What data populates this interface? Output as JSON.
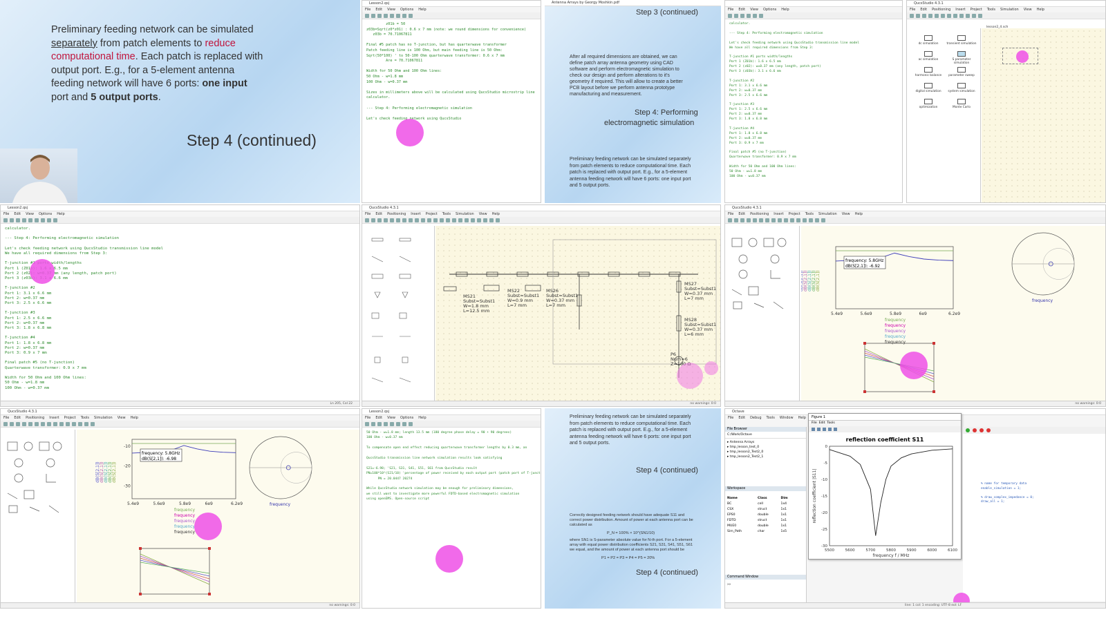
{
  "tiles": {
    "t1": {
      "text_lines": [
        {
          "parts": [
            [
              "Preliminary feeding network can be simulated",
              ""
            ]
          ]
        },
        {
          "parts": [
            [
              "separately",
              "u"
            ],
            [
              " from patch elements to ",
              ""
            ],
            [
              "reduce",
              "red"
            ]
          ]
        },
        {
          "parts": [
            [
              "computational time",
              "red"
            ],
            [
              ". Each patch is replaced with",
              ""
            ]
          ]
        },
        {
          "parts": [
            [
              "output port. E.g., for a 5-element antenna",
              ""
            ]
          ]
        },
        {
          "parts": [
            [
              "feeding network will have 6 ports: ",
              ""
            ],
            [
              "one input",
              "bold"
            ]
          ]
        },
        {
          "parts": [
            [
              "port and ",
              ""
            ],
            [
              "5 output ports",
              "bold"
            ],
            [
              ".",
              ""
            ]
          ]
        }
      ],
      "step": "Step 4 (continued)"
    },
    "t2": {
      "title": "Lesson2.qsj",
      "menu": [
        "File",
        "Edit",
        "View",
        "Options",
        "Help"
      ],
      "lines": [
        "         z01b = 50",
        "z03b=Sqrt(z0*z01) : 0.6 x 7 mm (note: we round dimensions for convenience)",
        "   z03b = 70.71067811",
        "",
        "Final #5 patch has no T-junction, but has quarterwave transformer",
        "Patch feeding line is 100 Ohm, but main feeding line is 50 Ohm:",
        "Sqrt(50*100) ' to 50-100 Ohm quarterwave transformer: 0.6 x 7 mm",
        "         Are = 70.71067811",
        "",
        "Width for 50 Ohm and 100 Ohm lines:",
        "50 Ohm - w=1.8 mm",
        "100 Ohm - w=0.37 mm",
        "",
        "Sizes in millimeters above will be calculated using QucsStudio microstrip line",
        "calculator.",
        "",
        "--- Step 4: Performing electromagnetic simulation",
        "",
        "Let's check feeding network using QucsStudio"
      ]
    },
    "t3": {
      "title": "Antenna Arrays by Georgy Moshkin.pdf",
      "step_top": "Step 3 (continued)",
      "para1": "After all required dimensions are obtained, we can define patch array antenna geometry using CAD software and perform electromagnetic simulation to check our design and perform alterations to it's geometry if required. This will allow to create a better PCB layout before we perform antenna prototype manufacturing and measurement.",
      "step4a": "Step 4: Performing",
      "step4b": "electromagnetic simulation",
      "para2": "Preliminary feeding network can be simulated separately from patch elements to reduce computational time. Each patch is replaced with output port. E.g., for a 5-element antenna feeding network will have 6 ports: one input port and 5 output ports."
    },
    "t4": {
      "lines": [
        "calculator.",
        "",
        "--- Step 4: Performing electromagnetic simulation",
        "",
        "Let's check feeding network using QucsStudio transmission line model",
        "We have all required dimensions from Step 3:",
        "",
        "T-junction #1 ports width/lengths",
        "Port 1 (Z01b): 1.6 x 6.5 mm",
        "Port 2 (z02): w=0.37 mm (any length, patch port)",
        "Port 3 (z03b): 3.1 x 6.6 mm",
        "",
        "T-junction #2",
        "Port 1: 3.1 x 6.6 mm",
        "Port 2: w=0.37 mm",
        "Port 3: 2.5 x 6.6 mm",
        "",
        "T-junction #3",
        "Port 1: 2.5 x 6.6 mm",
        "Port 2: w=0.37 mm",
        "Port 3: 1.8 x 6.8 mm",
        "",
        "T-junction #4",
        "Port 1: 1.8 x 6.8 mm",
        "Port 2: w=0.37 mm",
        "Port 3: 0.9 x 7 mm",
        "",
        "Final patch #5 (no T-junction)",
        "Quarterwave transformer: 0.9 x 7 mm",
        "",
        "Width for 50 Ohm and 100 Ohm lines:",
        "50 Ohm - w=1.8 mm",
        "100 Ohm - w=0.37 mm"
      ]
    },
    "t5": {
      "title": "QucsStudio 4.3.1",
      "tab": "lesson2_4.sch",
      "items": [
        "dc simulation",
        "transient simulation",
        "ac simulation",
        "S parameter simulation",
        "harmonic balance",
        "parameter sweep",
        "digital simulation",
        "system simulation",
        "optimization",
        "Monte Carlo"
      ]
    },
    "t6": {
      "title": "Lesson2.qsj",
      "lines": [
        "calculator.",
        "",
        "--- Step 4: Performing electromagnetic simulation",
        "",
        "Let's check feeding network using QucsStudio transmission line model",
        "We have all required dimensions from Step 3:",
        "",
        "T-junction #1 ports width/lengths",
        "Port 1 (Z01b): 1.6 x 6.5 mm",
        "Port 2 (z02): w=0.37 mm (any length, patch port)",
        "Port 3 (z03b): 3.1 x 6.6 mm",
        "",
        "T-junction #2",
        "Port 1: 3.1 x 6.6 mm",
        "Port 2: w=0.37 mm",
        "Port 3: 2.5 x 6.6 mm",
        "",
        "T-junction #3",
        "Port 1: 2.5 x 6.6 mm",
        "Port 2: w=0.37 mm",
        "Port 3: 1.8 x 6.8 mm",
        "",
        "T-junction #4",
        "Port 1: 1.8 x 6.8 mm",
        "Port 2: w=0.37 mm",
        "Port 3: 0.9 x 7 mm",
        "",
        "Final patch #5 (no T-junction)",
        "Quarterwave transformer: 0.9 x 7 mm",
        "",
        "Width for 50 Ohm and 100 Ohm lines:",
        "50 Ohm - w=1.8 mm",
        "100 Ohm - w=0.37 mm"
      ],
      "status": "Ln 205, Col 22"
    },
    "t7": {
      "title": "QucsStudio 4.3.1",
      "menu": [
        "File",
        "Edit",
        "Positioning",
        "Insert",
        "Project",
        "Tools",
        "Simulation",
        "View",
        "Help"
      ],
      "labels": [
        "MS21",
        "Subst=Subst1",
        "W=1.8 mm",
        "L=12.5 mm",
        "MS22",
        "Subst=Subst1",
        "W=0.9 mm",
        "L=7 mm",
        "MS26",
        "Subst=Subst1",
        "W=0.37 mm",
        "L=7 mm",
        "MS27",
        "Subst=Subst1",
        "W=0.37 mm",
        "L=7 mm",
        "MS28",
        "Subst=Subst1",
        "W=0.37 mm",
        "L=6 mm",
        "P6",
        "Num=6",
        "Z=100 Ω"
      ],
      "status": "no warnings: 0:0"
    },
    "t8": {
      "title": "QucsStudio 4.3.1",
      "marker1": "frequency: 5.8GHz",
      "marker2": "dB(S[2,1]): -6.92",
      "xticks": [
        "5.4e9",
        "5.6e9",
        "5.8e9",
        "6e9",
        "6.2e9"
      ],
      "legend": [
        "frequency",
        "frequency",
        "frequency",
        "frequency",
        "frequency"
      ],
      "smith_label": "frequency",
      "ylabel": "dB(S[2,1])",
      "ylabel2": "phase(S[2,1])",
      "xticks2": [
        "5.4e9",
        "5.6e9",
        "5.8e9",
        "6e9",
        "6.2e9"
      ],
      "status": "no warnings: 0:0"
    },
    "t9": {
      "title": "QucsStudio 4.3.1",
      "marker1": "frequency: 5.8GHz",
      "marker2": "dB(S[2,1]): -6.98",
      "yticks": [
        "-10",
        "-20",
        "-30"
      ],
      "xticks": [
        "5.4e9",
        "5.6e9",
        "5.8e9",
        "6e9",
        "6.2e9"
      ],
      "legend": [
        "frequency",
        "frequency",
        "frequency",
        "frequency",
        "frequency"
      ],
      "smith_label": "frequency",
      "status": "no warnings: 0:0"
    },
    "t10": {
      "title": "Lesson2.qsj",
      "lines": [
        "50 Ohm - w=1.8 mm; length 13.5 mm (180 degree phase delay = 90 + 90 degrees)",
        "100 Ohm - w=0.37 mm",
        "",
        "To compensate open end effect reducing quarterwave transformer lengths by 0.3 mm, an",
        "",
        "QucsStudio transmission line network simulation results look satisfying",
        "",
        "S21=-6.98; 'S21, S31, S41, S51, S61 from QucsStudio result",
        "PN=100*10^(S21/10) 'percentage of power received by each output port (patch port of T-junction)",
        "      PN = 20.0447 20274",
        "",
        "While QucsStudio network simulation may be enough for preliminary dimensions,",
        "we still want to investigate more powerful FDTD-based electromagnetic simulation",
        "using openEMS. Open-source script"
      ]
    },
    "t11": {
      "para1": "Preliminary feeding network can be simulated separately from patch elements to reduce computational time. Each patch is replaced with output port. E.g., for a 5-element antenna feeding network will have 6 ports: one input port and 5 output ports.",
      "step_mid": "Step 4 (continued)",
      "para2": "Correctly designed feeding network should have adequate S11 and correct power distribution. Amount of power at each antenna port can be calculated as",
      "formula1": "P_N = 100% × 10^(SN1/10)",
      "para3": "where SN1 is S-parameter absolute value for N-th port. For a 5-element array with equal power distribution coefficients S21, S31, S41, S51, S61 we equal, and the amount of power at each antenna port should be",
      "formula2": "P1 = P2 = P3 = P4 = P5 = 20%",
      "step_bottom": "Step 4 (continued)"
    },
    "t12": {
      "title": "Octave",
      "file_browser": "File Browser",
      "dir": "C:/Work/Octave",
      "files": [
        "Antenna Arrays",
        "tmp_lesson_test_0",
        "tmp_lesson2_Test2_0",
        "tmp_lesson2_Test2_1"
      ],
      "ws_cols": [
        "Name",
        "Class",
        "Dim"
      ],
      "ws_rows": [
        [
          "BC",
          "cell",
          "1x4"
        ],
        [
          "CSX",
          "struct",
          "1x1"
        ],
        [
          "EPS0",
          "double",
          "1x1"
        ],
        [
          "FDTD",
          "struct",
          "1x1"
        ],
        [
          "MUE0",
          "double",
          "1x1"
        ],
        [
          "Sim_Path",
          "char",
          "1x5"
        ]
      ],
      "cmd_title": "Command Window",
      "figure_title": "Figure 1",
      "plot_title": "reflection coefficient S11",
      "xlabel": "frequency f / MHz",
      "ylabel": "reflection coefficient |S11|",
      "xticks": [
        "5500",
        "5600",
        "5700",
        "5800",
        "5900",
        "6000",
        "6100"
      ],
      "yticks": [
        "0",
        "-5",
        "-10",
        "-15",
        "-20",
        "-25",
        "-30"
      ],
      "editor_lines": [
        "% name for temporary data",
        "enable_simulation = 1;",
        "",
        "% draw_complex_impedance = 0;",
        "draw_all = 1;"
      ],
      "status": "line: 1   col: 1   encoding: UTF-8   eol: LF"
    }
  },
  "chart_data": [
    {
      "type": "line",
      "title": "",
      "xlabel": "",
      "ylabel": "dB(S[2,1])",
      "x": [
        5.4,
        5.5,
        5.6,
        5.7,
        5.8,
        5.9,
        6.0,
        6.1,
        6.2
      ],
      "series": [
        {
          "values": [
            -10.5,
            -10.2,
            -10.0,
            -9.2,
            -6.92,
            -8.5,
            -9.6,
            -10.1,
            -10.3
          ]
        }
      ],
      "xlim": [
        5.4,
        6.2
      ]
    },
    {
      "type": "line",
      "title": "reflection coefficient S11",
      "xlabel": "frequency f / MHz",
      "ylabel": "reflection coefficient |S11|",
      "x": [
        5500,
        5600,
        5650,
        5700,
        5725,
        5750,
        5775,
        5800,
        5850,
        5900,
        6000,
        6100
      ],
      "series": [
        {
          "values": [
            -1.0,
            -3.0,
            -5.5,
            -13.0,
            -27.0,
            -17.0,
            -10.0,
            -6.0,
            -3.5,
            -2.3,
            -1.2,
            -0.8
          ]
        }
      ],
      "xlim": [
        5500,
        6100
      ],
      "ylim": [
        -30,
        0
      ]
    }
  ],
  "colors": {
    "highlight": "#ee50e6",
    "code_green": "#2c8a2c",
    "canvas": "#fbf7e1",
    "accent_red": "#c0143c"
  }
}
